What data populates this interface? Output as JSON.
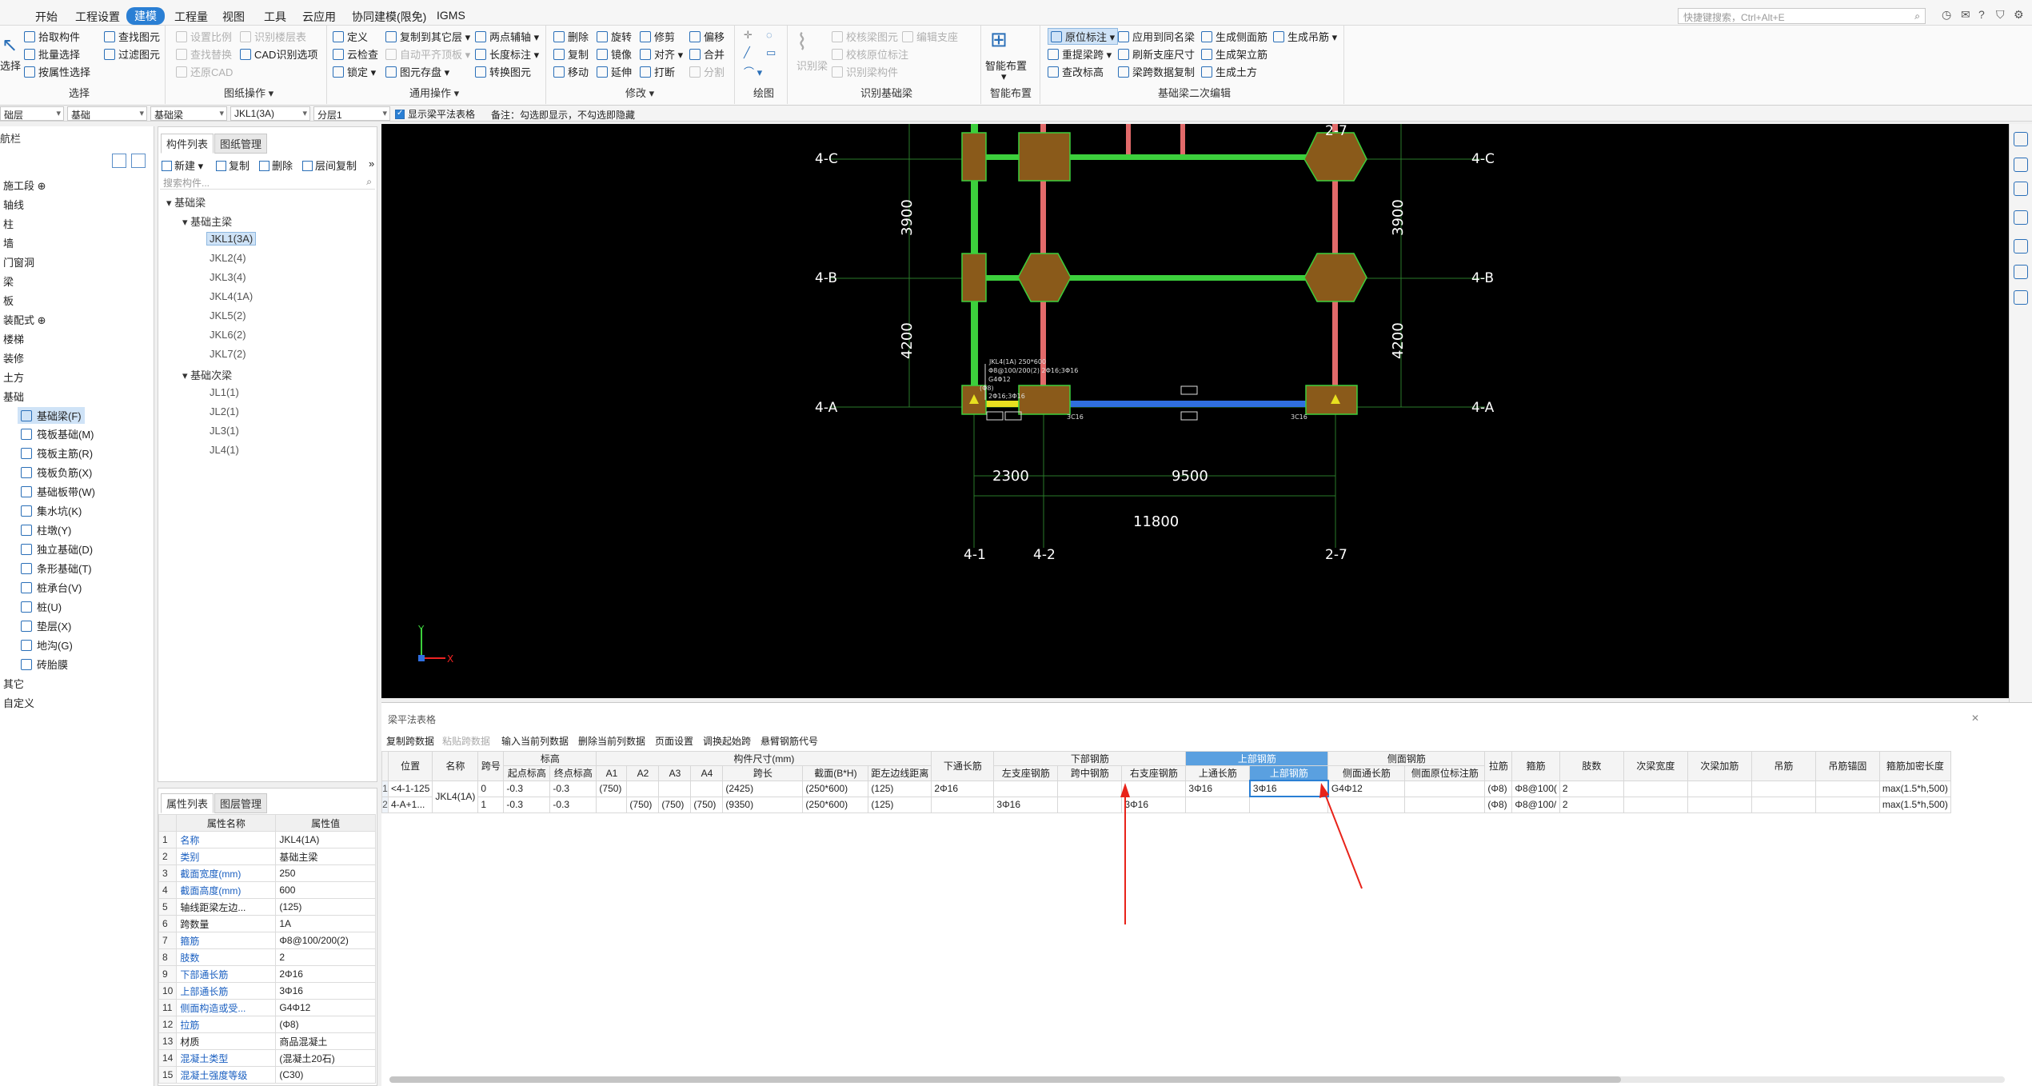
{
  "tabs": [
    "开始",
    "工程设置",
    "建模",
    "工程量",
    "视图",
    "工具",
    "云应用",
    "协同建模(限免)",
    "IGMS"
  ],
  "search_placeholder": "快捷键搜索，Ctrl+Alt+E",
  "ribbon": {
    "select_label": "选择",
    "col1": [
      "拾取构件",
      "批量选择",
      "按属性选择"
    ],
    "col2": [
      "查找图元",
      "过滤图元"
    ],
    "col3": [
      "设置比例",
      "查找替换",
      "还原CAD"
    ],
    "col4": [
      "识别楼层表",
      "CAD识别选项"
    ],
    "col5": [
      "定义",
      "云检查",
      "锁定 ▾"
    ],
    "col6": [
      "复制到其它层 ▾",
      "自动平齐顶板 ▾",
      "图元存盘 ▾"
    ],
    "col7": [
      "两点辅轴 ▾",
      "长度标注 ▾",
      "转换图元"
    ],
    "col8": [
      "删除",
      "复制",
      "移动"
    ],
    "col9": [
      "旋转",
      "镜像",
      "延伸"
    ],
    "col10": [
      "修剪",
      "对齐 ▾",
      "打断"
    ],
    "col11": [
      "偏移",
      "合并",
      "分割"
    ],
    "col13": [
      "识别梁"
    ],
    "col14": [
      "校核梁图元",
      "校核原位标注",
      "识别梁构件"
    ],
    "col15": [
      "编辑支座"
    ],
    "col16": [
      "智能布置",
      "▾"
    ],
    "col17": [
      "原位标注 ▾",
      "重提梁跨 ▾",
      "查改标高"
    ],
    "col18": [
      "应用到同名梁",
      "刷新支座尺寸",
      "梁跨数据复制"
    ],
    "col19": [
      "生成侧面筋",
      "生成架立筋",
      "生成土方"
    ],
    "col20": [
      "生成吊筋 ▾"
    ],
    "groups": [
      "选择",
      "图纸操作 ▾",
      "通用操作 ▾",
      "修改 ▾",
      "绘图",
      "识别基础梁",
      "智能布置",
      "基础梁二次编辑"
    ]
  },
  "filterbar": {
    "combos": [
      "础层",
      "基础",
      "基础梁",
      "JKL1(3A)",
      "分层1"
    ],
    "checkbox_label": "显示梁平法表格",
    "note": "备注：勾选即显示，不勾选即隐藏"
  },
  "nav": {
    "header": "航栏",
    "items": [
      "施工段 ⊕",
      "轴线",
      "柱",
      "墙",
      "门窗洞",
      "梁",
      "板",
      "装配式 ⊕",
      "楼梯",
      "装修",
      "土方",
      "基础"
    ],
    "sub": [
      "基础梁(F)",
      "筏板基础(M)",
      "筏板主筋(R)",
      "筏板负筋(X)",
      "基础板带(W)",
      "集水坑(K)",
      "柱墩(Y)",
      "独立基础(D)",
      "条形基础(T)",
      "桩承台(V)",
      "桩(U)",
      "垫层(X)",
      "地沟(G)",
      "砖胎膜"
    ],
    "tail": [
      "其它",
      "自定义"
    ]
  },
  "complist": {
    "tabs": [
      "构件列表",
      "图纸管理"
    ],
    "tools": [
      "新建 ▾",
      "复制",
      "删除",
      "层间复制",
      "»"
    ],
    "search_placeholder": "搜索构件...",
    "root": "基础梁",
    "group1": "基础主梁",
    "group1_items": [
      "JKL1(3A)",
      "JKL2(4)",
      "JKL3(4)",
      "JKL4(1A)",
      "JKL5(2)",
      "JKL6(2)",
      "JKL7(2)"
    ],
    "group2": "基础次梁",
    "group2_items": [
      "JL1(1)",
      "JL2(1)",
      "JL3(1)",
      "JL4(1)"
    ]
  },
  "props": {
    "tabs": [
      "属性列表",
      "图层管理"
    ],
    "headers": [
      "属性名称",
      "属性值"
    ],
    "rows": [
      {
        "n": "1",
        "k": "名称",
        "v": "JKL4(1A)"
      },
      {
        "n": "2",
        "k": "类别",
        "v": "基础主梁"
      },
      {
        "n": "3",
        "k": "截面宽度(mm)",
        "v": "250"
      },
      {
        "n": "4",
        "k": "截面高度(mm)",
        "v": "600"
      },
      {
        "n": "5",
        "k": "轴线距梁左边...",
        "v": "(125)"
      },
      {
        "n": "6",
        "k": "跨数量",
        "v": "1A"
      },
      {
        "n": "7",
        "k": "箍筋",
        "v": "Φ8@100/200(2)"
      },
      {
        "n": "8",
        "k": "肢数",
        "v": "2"
      },
      {
        "n": "9",
        "k": "下部通长筋",
        "v": "2Φ16"
      },
      {
        "n": "10",
        "k": "上部通长筋",
        "v": "3Φ16"
      },
      {
        "n": "11",
        "k": "侧面构造或受...",
        "v": "G4Φ12"
      },
      {
        "n": "12",
        "k": "拉筋",
        "v": "(Φ8)"
      },
      {
        "n": "13",
        "k": "材质",
        "v": "商品混凝土"
      },
      {
        "n": "14",
        "k": "混凝土类型",
        "v": "(混凝土20石)"
      },
      {
        "n": "15",
        "k": "混凝土强度等级",
        "v": "(C30)"
      }
    ]
  },
  "canvas": {
    "axis_labels": {
      "c": "4-C",
      "b": "4-B",
      "a": "4-A",
      "x1": "4-1",
      "x2": "4-2",
      "x7": "2-7"
    },
    "dims": {
      "d3900": "3900",
      "d4200": "4200",
      "d2300": "2300",
      "d9500": "9500",
      "d11800": "11800"
    },
    "annotation": [
      "JKL4(1A) 250*600",
      "Φ8@100/200(2) 2Φ16;3Φ16",
      "G4Φ12",
      "(Φ8)",
      "2Φ16;3Φ16"
    ],
    "tags": [
      "3C16",
      "3C16"
    ],
    "coord_x": "X",
    "coord_y": "Y"
  },
  "table": {
    "title": "梁平法表格",
    "tools": [
      "复制跨数据",
      "粘贴跨数据",
      "输入当前列数据",
      "删除当前列数据",
      "页面设置",
      "调换起始跨",
      "悬臂钢筋代号"
    ],
    "group_headers": {
      "elev": "标高",
      "size": "构件尺寸(mm)",
      "bottom": "下部钢筋",
      "top": "上部钢筋",
      "side": "侧面钢筋"
    },
    "headers": [
      "位置",
      "名称",
      "跨号",
      "起点标高",
      "终点标高",
      "A1",
      "A2",
      "A3",
      "A4",
      "跨长",
      "截面(B*H)",
      "距左边线距离",
      "下通长筋",
      "左支座钢筋",
      "跨中钢筋",
      "右支座钢筋",
      "上通长筋",
      "上部钢筋",
      "侧面通长筋",
      "侧面原位标注筋",
      "拉筋",
      "箍筋",
      "肢数",
      "次梁宽度",
      "次梁加筋",
      "吊筋",
      "吊筋锚固",
      "箍筋加密长度"
    ],
    "name_merged": "JKL4(1A)",
    "rows": [
      {
        "rn": "1",
        "pos": "<4-1-125",
        "span": "0",
        "e1": "-0.3",
        "e2": "-0.3",
        "a1": "(750)",
        "a2": "",
        "a3": "",
        "a4": "",
        "len": "(2425)",
        "sec": "(250*600)",
        "dist": "(125)",
        "btm": "2Φ16",
        "ls": "",
        "mid": "",
        "rs": "",
        "topc": "3Φ16",
        "topr": "3Φ16",
        "side": "G4Φ12",
        "sideo": "",
        "tie": "(Φ8)",
        "stir": "Φ8@100(",
        "legs": "2",
        "sw": "",
        "sa": "",
        "hang": "",
        "ha": "",
        "dense": "max(1.5*h,500)"
      },
      {
        "rn": "2",
        "pos": "4-A+1...",
        "span": "1",
        "e1": "-0.3",
        "e2": "-0.3",
        "a1": "",
        "a2": "(750)",
        "a3": "(750)",
        "a4": "(750)",
        "len": "(9350)",
        "sec": "(250*600)",
        "dist": "(125)",
        "btm": "",
        "ls": "3Φ16",
        "mid": "",
        "rs": "3Φ16",
        "topc": "",
        "topr": "",
        "side": "",
        "sideo": "",
        "tie": "(Φ8)",
        "stir": "Φ8@100/",
        "legs": "2",
        "sw": "",
        "sa": "",
        "hang": "",
        "ha": "",
        "dense": "max(1.5*h,500)"
      }
    ]
  },
  "colors": {
    "accent": "#2a7fd4",
    "beam_green": "#3ccf3c",
    "beam_red": "#e26a6a",
    "beam_blue": "#2f6fe0",
    "pile_brown": "#8a5a1a",
    "arrow": "#e8231a"
  }
}
